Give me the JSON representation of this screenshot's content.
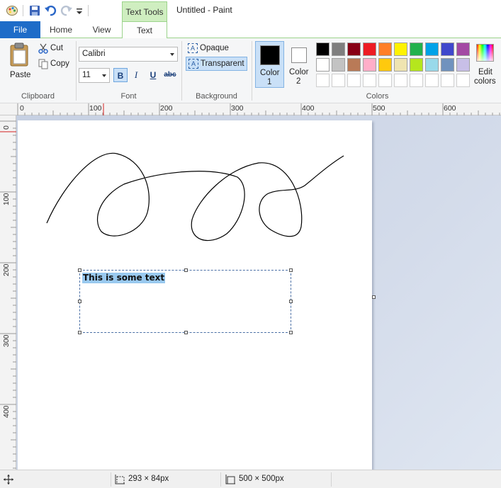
{
  "window": {
    "title": "Untitled - Paint",
    "context_tab": "Text Tools"
  },
  "tabs": [
    "File",
    "Home",
    "View",
    "Text"
  ],
  "active_tab": "Text",
  "ribbon": {
    "clipboard": {
      "group_label": "Clipboard",
      "paste": "Paste",
      "cut": "Cut",
      "copy": "Copy"
    },
    "font": {
      "group_label": "Font",
      "family": "Calibri",
      "size": "11",
      "bold_active": true
    },
    "background": {
      "group_label": "Background",
      "opaque": "Opaque",
      "transparent": "Transparent",
      "selected": "Transparent"
    },
    "colors": {
      "group_label": "Colors",
      "color1_label": "Color\n1",
      "color1_line1": "Color",
      "color1_line2": "1",
      "color2_line1": "Color",
      "color2_line2": "2",
      "color1_value": "#000000",
      "color2_value": "#ffffff",
      "edit_line1": "Edit",
      "edit_line2": "colors",
      "palette_row1": [
        "#000000",
        "#7f7f7f",
        "#880015",
        "#ed1c24",
        "#ff7f27",
        "#fff200",
        "#22b14c",
        "#00a2e8",
        "#3f48cc",
        "#a349a4"
      ],
      "palette_row2": [
        "#ffffff",
        "#c3c3c3",
        "#b97a57",
        "#ffaec9",
        "#ffc90e",
        "#efe4b0",
        "#b5e61d",
        "#99d9ea",
        "#7092be",
        "#c8bfe7"
      ],
      "palette_row3_count": 10
    }
  },
  "ruler": {
    "horizontal": [
      "0",
      "100",
      "200",
      "300",
      "400",
      "500",
      "600"
    ],
    "vertical": [
      "0",
      "100",
      "200",
      "300",
      "400"
    ]
  },
  "canvas": {
    "text_content": "This is some text"
  },
  "status": {
    "selection_size": "293 × 84px",
    "image_size": "500 × 500px"
  },
  "icons": [
    "paint-app-icon",
    "save-icon",
    "undo-icon",
    "redo-icon",
    "customize-qat-icon",
    "paste-icon",
    "cut-icon",
    "copy-icon",
    "edit-colors-icon",
    "cursor-position-icon",
    "selection-size-icon",
    "image-size-icon"
  ]
}
